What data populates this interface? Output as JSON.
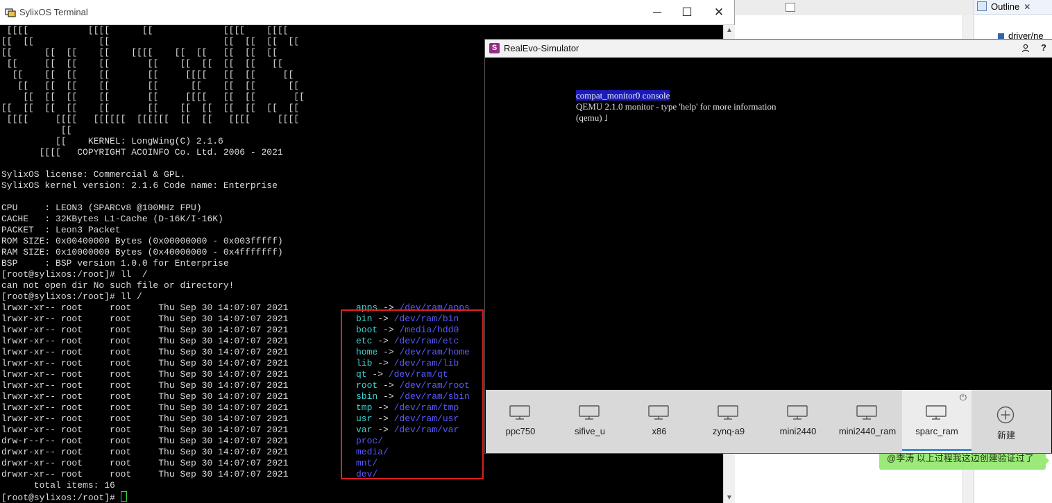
{
  "ide": {
    "outline_title": "Outline",
    "outline_item": "driver/ne"
  },
  "terminal": {
    "title": "SylixOS Terminal",
    "controls": {
      "minimize": "─",
      "maximize": "☐",
      "close": "✕"
    },
    "banner": [
      " [[[[           [[[[      [[             [[[[    [[[[",
      "[[  [[            [[                     [[  [[  [[  [[",
      "[[      [[  [[    [[    [[[[    [[  [[   [[  [[  [[",
      " [[     [[  [[    [[       [[    [[  [[  [[  [[   [[",
      "  [[    [[  [[    [[       [[     [[[[   [[  [[     [[",
      "   [[   [[  [[    [[       [[      [[    [[  [[      [[",
      "    [[  [[  [[    [[       [[     [[[[   [[  [[       [[",
      "[[  [[  [[  [[    [[       [[    [[  [[  [[  [[  [[  [[",
      " [[[[     [[[[   [[[[[[  [[[[[[  [[  [[   [[[[     [[[[",
      "           [[",
      "          [[    KERNEL: LongWing(C) 2.1.6",
      "       [[[[   COPYRIGHT ACOINFO Co. Ltd. 2006 - 2021"
    ],
    "info": [
      "SylixOS license: Commercial & GPL.",
      "SylixOS kernel version: 2.1.6 Code name: Enterprise",
      "",
      "CPU     : LEON3 (SPARCv8 @100MHz FPU)",
      "CACHE   : 32KBytes L1-Cache (D-16K/I-16K)",
      "PACKET  : Leon3 Packet",
      "ROM SIZE: 0x00400000 Bytes (0x00000000 - 0x003fffff)",
      "RAM SIZE: 0x10000000 Bytes (0x40000000 - 0x4fffffff)",
      "BSP     : BSP version 1.0.0 for Enterprise",
      "[root@sylixos:/root]# ll  /",
      "can not open dir No such file or directory!",
      "[root@sylixos:/root]# ll /"
    ],
    "listing": [
      {
        "meta": "lrwxr-xr-- root     root     Thu Sep 30 14:07:07 2021",
        "name": "apps",
        "target": "/dev/ram/apps"
      },
      {
        "meta": "lrwxr-xr-- root     root     Thu Sep 30 14:07:07 2021",
        "name": "bin",
        "target": "/dev/ram/bin"
      },
      {
        "meta": "lrwxr-xr-- root     root     Thu Sep 30 14:07:07 2021",
        "name": "boot",
        "target": "/media/hdd0"
      },
      {
        "meta": "lrwxr-xr-- root     root     Thu Sep 30 14:07:07 2021",
        "name": "etc",
        "target": "/dev/ram/etc"
      },
      {
        "meta": "lrwxr-xr-- root     root     Thu Sep 30 14:07:07 2021",
        "name": "home",
        "target": "/dev/ram/home"
      },
      {
        "meta": "lrwxr-xr-- root     root     Thu Sep 30 14:07:07 2021",
        "name": "lib",
        "target": "/dev/ram/lib"
      },
      {
        "meta": "lrwxr-xr-- root     root     Thu Sep 30 14:07:07 2021",
        "name": "qt",
        "target": "/dev/ram/qt"
      },
      {
        "meta": "lrwxr-xr-- root     root     Thu Sep 30 14:07:07 2021",
        "name": "root",
        "target": "/dev/ram/root"
      },
      {
        "meta": "lrwxr-xr-- root     root     Thu Sep 30 14:07:07 2021",
        "name": "sbin",
        "target": "/dev/ram/sbin"
      },
      {
        "meta": "lrwxr-xr-- root     root     Thu Sep 30 14:07:07 2021",
        "name": "tmp",
        "target": "/dev/ram/tmp"
      },
      {
        "meta": "lrwxr-xr-- root     root     Thu Sep 30 14:07:07 2021",
        "name": "usr",
        "target": "/dev/ram/usr"
      },
      {
        "meta": "lrwxr-xr-- root     root     Thu Sep 30 14:07:07 2021",
        "name": "var",
        "target": "/dev/ram/var"
      },
      {
        "meta": "drw-r--r-- root     root     Thu Sep 30 14:07:07 2021",
        "name": "proc/",
        "target": ""
      },
      {
        "meta": "drwxr-xr-- root     root     Thu Sep 30 14:07:07 2021",
        "name": "media/",
        "target": ""
      },
      {
        "meta": "drwxr-xr-- root     root     Thu Sep 30 14:07:07 2021",
        "name": "mnt/",
        "target": ""
      },
      {
        "meta": "drwxr-xr-- root     root     Thu Sep 30 14:07:07 2021",
        "name": "dev/",
        "target": ""
      }
    ],
    "link_arrow": " -> ",
    "total": "      total items: 16",
    "prompt": "[root@sylixos:/root]# "
  },
  "simulator": {
    "title": "RealEvo-Simulator",
    "console_lines": [
      "compat_monitor0 console",
      "QEMU 2.1.0 monitor - type 'help' for more information",
      "(qemu) ˩"
    ],
    "boards": [
      {
        "label": "ppc750"
      },
      {
        "label": "sifive_u"
      },
      {
        "label": "x86"
      },
      {
        "label": "zynq-a9"
      },
      {
        "label": "mini2440"
      },
      {
        "label": "mini2440_ram"
      },
      {
        "label": "sparc_ram",
        "selected": true
      }
    ],
    "new_label": "新建"
  },
  "chat": {
    "message": "@李涛 以上过程我这边创建验证过了"
  },
  "colors": {
    "link_name": "#3fd3d3",
    "link_target": "#5a5aff",
    "highlight": "#e02020",
    "selection_underline": "#3b8ed8",
    "chat_bubble": "#9bea79"
  }
}
